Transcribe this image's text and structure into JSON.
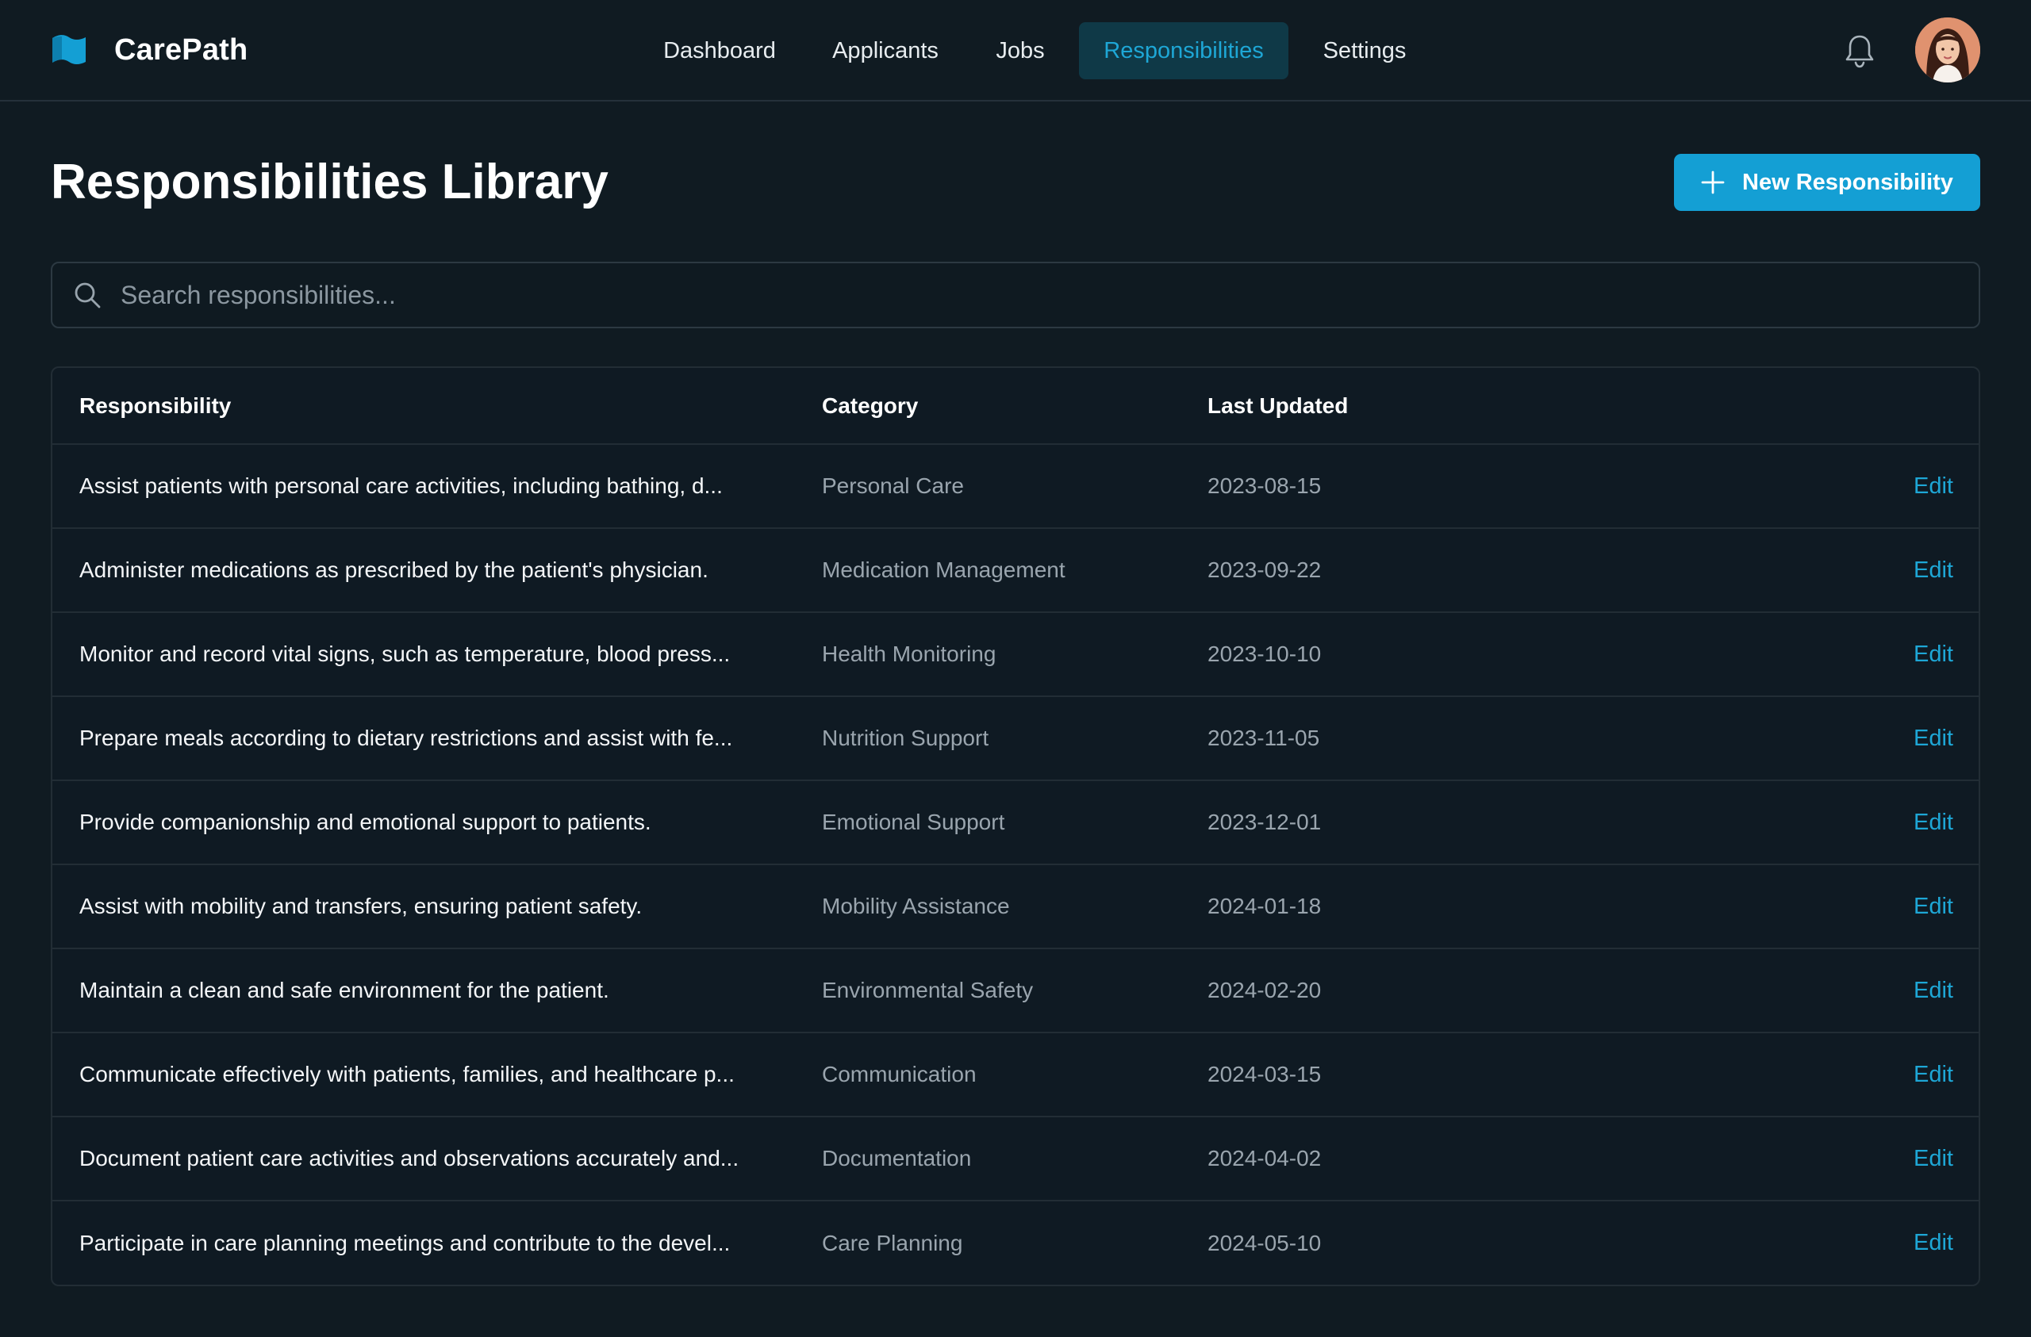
{
  "app": {
    "name": "CarePath",
    "colors": {
      "accent": "#149fd4",
      "background": "#101b22",
      "nav_active_bg": "#0f3947"
    }
  },
  "nav": {
    "items": [
      {
        "label": "Dashboard",
        "active": false
      },
      {
        "label": "Applicants",
        "active": false
      },
      {
        "label": "Jobs",
        "active": false
      },
      {
        "label": "Responsibilities",
        "active": true
      },
      {
        "label": "Settings",
        "active": false
      }
    ]
  },
  "header": {
    "icons": [
      "bell-icon",
      "avatar"
    ]
  },
  "page": {
    "title": "Responsibilities Library",
    "new_button_label": "New Responsibility"
  },
  "search": {
    "placeholder": "Search responsibilities...",
    "value": ""
  },
  "table": {
    "columns": [
      "Responsibility",
      "Category",
      "Last Updated",
      ""
    ],
    "rows": [
      {
        "responsibility": "Assist patients with personal care activities, including bathing, d...",
        "category": "Personal Care",
        "last_updated": "2023-08-15",
        "action": "Edit"
      },
      {
        "responsibility": "Administer medications as prescribed by the patient's physician.",
        "category": "Medication Management",
        "last_updated": "2023-09-22",
        "action": "Edit"
      },
      {
        "responsibility": "Monitor and record vital signs, such as temperature, blood press...",
        "category": "Health Monitoring",
        "last_updated": "2023-10-10",
        "action": "Edit"
      },
      {
        "responsibility": "Prepare meals according to dietary restrictions and assist with fe...",
        "category": "Nutrition Support",
        "last_updated": "2023-11-05",
        "action": "Edit"
      },
      {
        "responsibility": "Provide companionship and emotional support to patients.",
        "category": "Emotional Support",
        "last_updated": "2023-12-01",
        "action": "Edit"
      },
      {
        "responsibility": "Assist with mobility and transfers, ensuring patient safety.",
        "category": "Mobility Assistance",
        "last_updated": "2024-01-18",
        "action": "Edit"
      },
      {
        "responsibility": "Maintain a clean and safe environment for the patient.",
        "category": "Environmental Safety",
        "last_updated": "2024-02-20",
        "action": "Edit"
      },
      {
        "responsibility": "Communicate effectively with patients, families, and healthcare p...",
        "category": "Communication",
        "last_updated": "2024-03-15",
        "action": "Edit"
      },
      {
        "responsibility": "Document patient care activities and observations accurately and...",
        "category": "Documentation",
        "last_updated": "2024-04-02",
        "action": "Edit"
      },
      {
        "responsibility": "Participate in care planning meetings and contribute to the devel...",
        "category": "Care Planning",
        "last_updated": "2024-05-10",
        "action": "Edit"
      }
    ]
  }
}
